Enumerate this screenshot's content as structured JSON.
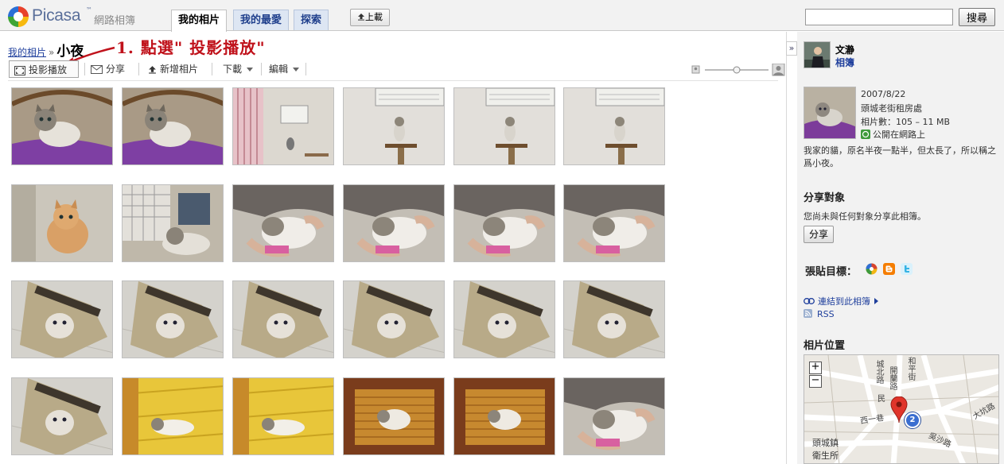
{
  "header": {
    "logo_text": "Picasa",
    "logo_tm": "™",
    "logo_sub": "網路相簿",
    "tabs": [
      {
        "label": "我的相片",
        "active": true
      },
      {
        "label": "我的最愛",
        "active": false
      },
      {
        "label": "探索",
        "active": false
      }
    ],
    "upload_label": "上載",
    "search_value": "",
    "search_button": "搜尋"
  },
  "breadcrumb": {
    "root": "我的相片",
    "separator": "»",
    "album": "小夜"
  },
  "annotation": "1. 點選\" 投影播放\"",
  "toolbar": {
    "slideshow": "投影播放",
    "share": "分享",
    "add_photos": "新增相片",
    "download": "下載",
    "edit": "編輯"
  },
  "photos": [
    {
      "row": 0,
      "col": 0,
      "scene": "kitten-purple"
    },
    {
      "row": 0,
      "col": 1,
      "scene": "kitten-purple"
    },
    {
      "row": 0,
      "col": 2,
      "scene": "room-curtain"
    },
    {
      "row": 0,
      "col": 3,
      "scene": "room-ac"
    },
    {
      "row": 0,
      "col": 4,
      "scene": "room-ac"
    },
    {
      "row": 0,
      "col": 5,
      "scene": "room-ac"
    },
    {
      "row": 1,
      "col": 0,
      "scene": "orange-kitten"
    },
    {
      "row": 1,
      "col": 1,
      "scene": "kitten-cage"
    },
    {
      "row": 1,
      "col": 2,
      "scene": "cat-held"
    },
    {
      "row": 1,
      "col": 3,
      "scene": "cat-held"
    },
    {
      "row": 1,
      "col": 4,
      "scene": "cat-held"
    },
    {
      "row": 1,
      "col": 5,
      "scene": "cat-held"
    },
    {
      "row": 2,
      "col": 0,
      "scene": "cat-bag"
    },
    {
      "row": 2,
      "col": 1,
      "scene": "cat-bag"
    },
    {
      "row": 2,
      "col": 2,
      "scene": "cat-bag"
    },
    {
      "row": 2,
      "col": 3,
      "scene": "cat-bag"
    },
    {
      "row": 2,
      "col": 4,
      "scene": "cat-bag"
    },
    {
      "row": 2,
      "col": 5,
      "scene": "cat-bag"
    },
    {
      "row": 3,
      "col": 0,
      "scene": "cat-bag"
    },
    {
      "row": 3,
      "col": 1,
      "scene": "cat-yellow"
    },
    {
      "row": 3,
      "col": 2,
      "scene": "cat-yellow"
    },
    {
      "row": 3,
      "col": 3,
      "scene": "cat-chair"
    },
    {
      "row": 3,
      "col": 4,
      "scene": "cat-chair"
    },
    {
      "row": 3,
      "col": 5,
      "scene": "cat-held"
    }
  ],
  "sidebar": {
    "owner_name": "文瀞",
    "owner_link": "相簿",
    "album_date": "2007/8/22",
    "album_location": "頭城老街租房處",
    "album_stats": "相片數：105 – 11 MB",
    "album_visibility": "公開在網路上",
    "album_description": "我家的貓，原名半夜一點半，但太長了，所以稱之爲小夜。",
    "share_heading": "分享對象",
    "share_text": "您尚未與任何對象分享此相簿。",
    "share_button": "分享",
    "post_label": "張貼目標：",
    "link_album": "連結到此相簿",
    "rss": "RSS",
    "map_heading": "相片位置",
    "map_marker": "2",
    "map_labels": [
      "頭城鎮",
      "衛生所",
      "和平街",
      "開蘭路",
      "大坑路",
      "吳沙路",
      "西一巷",
      "民",
      "城北路"
    ]
  },
  "colors": {
    "link": "#1f3f9c",
    "annotation": "#c0121b",
    "tab_bg": "#dde6f3"
  }
}
